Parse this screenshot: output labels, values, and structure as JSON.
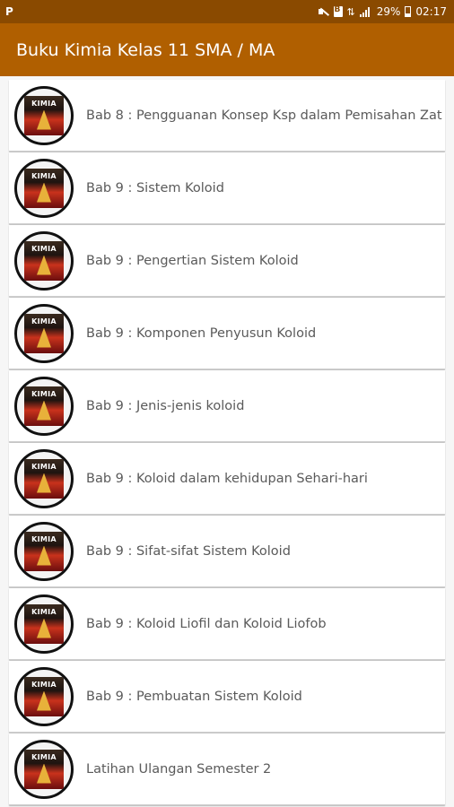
{
  "status_bar": {
    "carrier_icon": "P",
    "battery_percent": "29%",
    "time": "02:17",
    "icons": [
      "mute-icon",
      "document-icon",
      "data-arrows-icon",
      "signal-icon",
      "battery-icon"
    ]
  },
  "app_bar": {
    "title": "Buku Kimia Kelas 11 SMA / MA"
  },
  "list": {
    "items": [
      {
        "label": "Bab 8 : Pengguanan Konsep Ksp dalam Pemisahan Zat"
      },
      {
        "label": "Bab 9 : Sistem Koloid"
      },
      {
        "label": "Bab 9 : Pengertian Sistem Koloid"
      },
      {
        "label": "Bab 9 : Komponen Penyusun Koloid"
      },
      {
        "label": "Bab 9 : Jenis-jenis koloid"
      },
      {
        "label": "Bab 9 : Koloid dalam kehidupan Sehari-hari"
      },
      {
        "label": "Bab 9 : Sifat-sifat Sistem Koloid"
      },
      {
        "label": "Bab 9 : Koloid Liofil dan Koloid Liofob"
      },
      {
        "label": "Bab 9 : Pembuatan Sistem Koloid"
      },
      {
        "label": "Latihan Ulangan Semester 2"
      }
    ],
    "thumbnail_title": "KIMIA"
  },
  "colors": {
    "status_bar": "#8a4a00",
    "app_bar": "#b05f00",
    "background": "#f6f6f6"
  }
}
